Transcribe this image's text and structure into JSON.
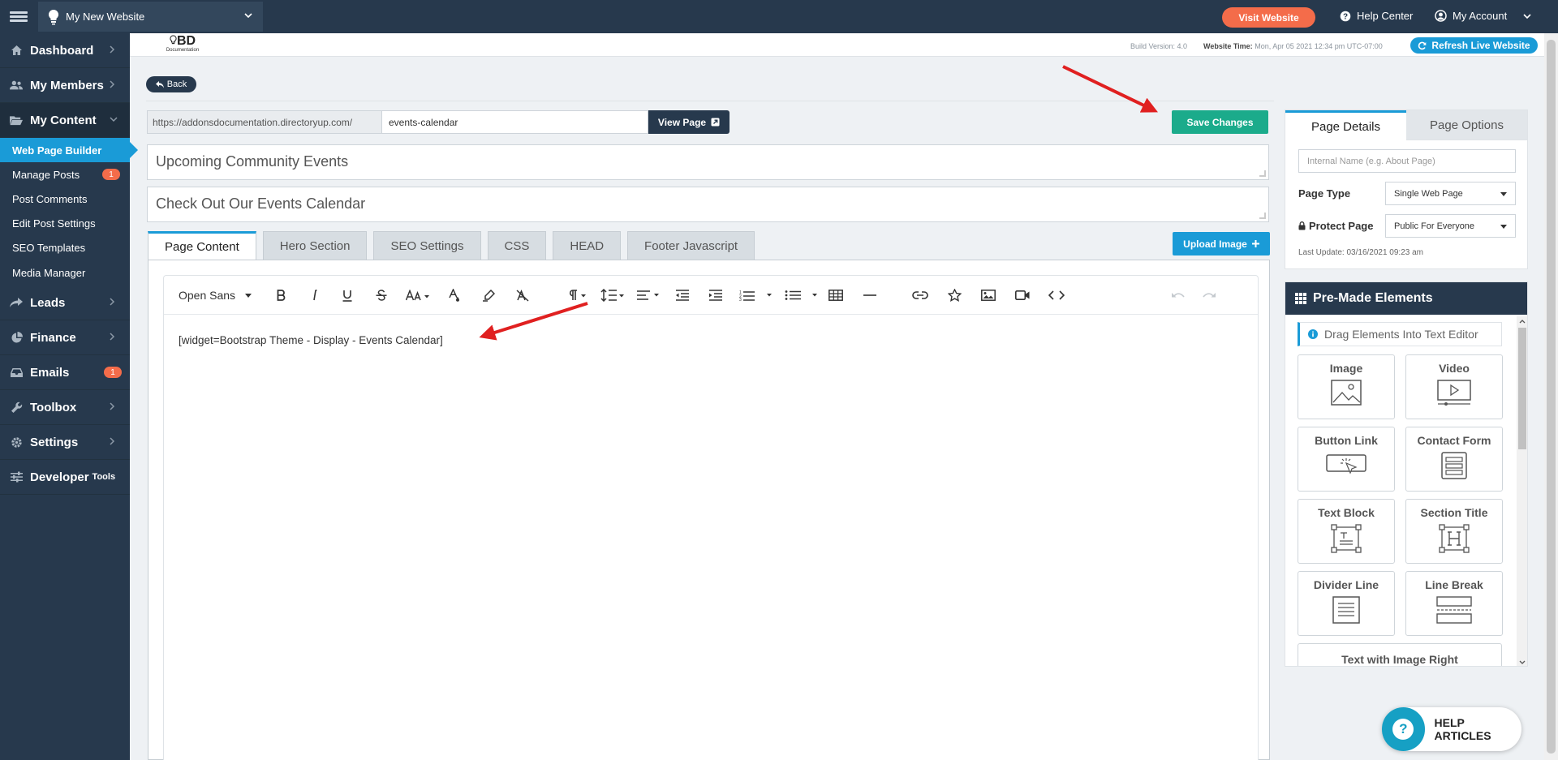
{
  "topbar": {
    "site_name": "My New Website",
    "visit_label": "Visit Website",
    "help_label": "Help Center",
    "account_label": "My Account"
  },
  "sidebar": {
    "items": [
      {
        "label": "Dashboard"
      },
      {
        "label": "My Members"
      },
      {
        "label": "My Content"
      },
      {
        "label": "Leads"
      },
      {
        "label": "Finance"
      },
      {
        "label": "Emails",
        "badge": "1"
      },
      {
        "label": "Toolbox"
      },
      {
        "label": "Settings"
      },
      {
        "label": "Developer",
        "suffix": "Tools"
      }
    ],
    "sub_items": [
      {
        "label": "Web Page Builder"
      },
      {
        "label": "Manage Posts",
        "badge": "1"
      },
      {
        "label": "Post Comments"
      },
      {
        "label": "Edit Post Settings"
      },
      {
        "label": "SEO Templates"
      },
      {
        "label": "Media Manager"
      }
    ]
  },
  "header": {
    "logo_main": "BD",
    "logo_sub": "Documentation",
    "build_version": "Build Version: 4.0",
    "website_time_label": "Website Time:",
    "website_time_value": "Mon, Apr 05 2021 12:34 pm UTC-07:00",
    "refresh_label": "Refresh Live Website"
  },
  "page": {
    "back_label": "Back",
    "url_prefix": "https://addonsdocumentation.directoryup.com/",
    "url_slug": "events-calendar",
    "view_label": "View Page",
    "save_label": "Save Changes",
    "title": "Upcoming Community Events",
    "subtitle": "Check Out Our Events Calendar",
    "tabs": [
      {
        "label": "Page Content"
      },
      {
        "label": "Hero Section"
      },
      {
        "label": "SEO Settings"
      },
      {
        "label": "CSS"
      },
      {
        "label": "HEAD"
      },
      {
        "label": "Footer Javascript"
      }
    ],
    "upload_label": "Upload Image",
    "font_name": "Open Sans",
    "editor_content": "[widget=Bootstrap Theme - Display - Events Calendar]"
  },
  "page_details": {
    "tabs": [
      {
        "label": "Page Details"
      },
      {
        "label": "Page Options"
      }
    ],
    "internal_name_placeholder": "Internal Name (e.g. About Page)",
    "page_type_label": "Page Type",
    "page_type_value": "Single Web Page",
    "protect_label": "Protect Page",
    "protect_value": "Public For Everyone",
    "last_update": "Last Update: 03/16/2021 09:23 am"
  },
  "premade": {
    "title": "Pre-Made Elements",
    "hint": "Drag Elements Into Text Editor",
    "elements": [
      {
        "label": "Image"
      },
      {
        "label": "Video"
      },
      {
        "label": "Button Link"
      },
      {
        "label": "Contact Form"
      },
      {
        "label": "Text Block"
      },
      {
        "label": "Section Title"
      },
      {
        "label": "Divider Line"
      },
      {
        "label": "Line Break"
      },
      {
        "label": "Text with Image Right"
      }
    ]
  },
  "help_articles": "HELP ARTICLES",
  "colors": {
    "navy": "#27394d",
    "accent_blue": "#1a9bd7",
    "save_green": "#1bab8b",
    "orange": "#f46c4a",
    "annotation_red": "#e02020"
  }
}
